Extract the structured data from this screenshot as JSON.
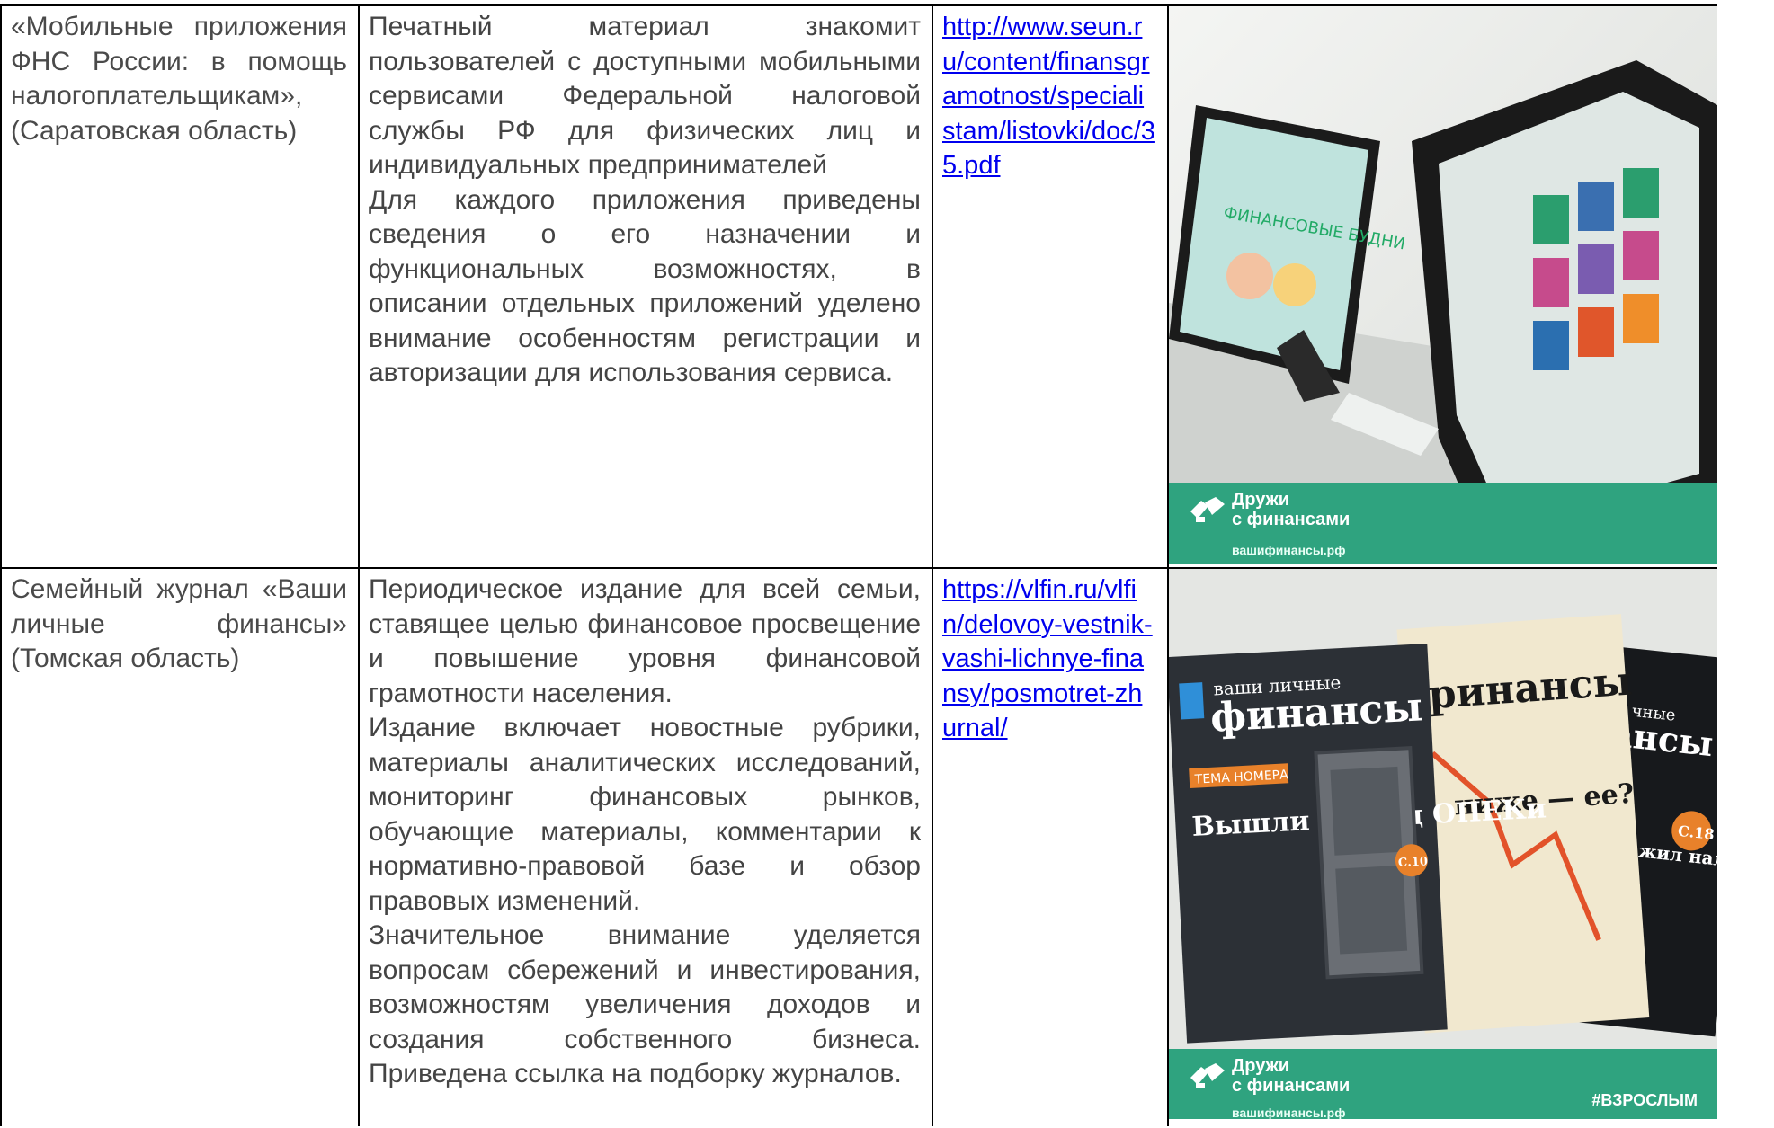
{
  "rows": [
    {
      "title": "«Мобильные приложения ФНС России: в помощь налогоплательщикам», (Саратовская область)",
      "desc": [
        "Печатный материал знакомит пользователей с доступными мобильными сервисами Федеральной налоговой службы РФ для физических лиц и индивидуальных предпринимателей",
        "Для каждого приложения приведены сведения о его назначении и функциональных возможностях, в описании отдельных приложений уделено внимание особенностям регистрации и авторизации для использования сервиса."
      ],
      "link": "http://www.seun.ru/content/finansgramotnost/specialistam/listovki/doc/35.pdf",
      "image": {
        "brand_line1": "Дружи",
        "brand_line2": "с финансами",
        "site": "вашифинансы.рф",
        "tablet_text": "ФИНАНСОВЫЕ БУДНИ"
      }
    },
    {
      "title": "Семейный журнал «Ваши личные финансы» (Томская область)",
      "desc": [
        "Периодическое издание для всей семьи, ставящее целью финансовое просвещение и повышение уровня финансовой грамотности населения.",
        "Издание включает новостные рубрики, материалы аналитических исследований, мониторинг финансовых рынков, обучающие материалы, комментарии к нормативно-правовой базе и обзор правовых изменений.",
        "Значительное внимание уделяется вопросам сбережений и инвестирования, возможностям увеличения доходов и создания собственного бизнеса. Приведена ссылка на подборку журналов."
      ],
      "link": "https://vlfin.ru/vlfin/delovoy-vestnik-vashi-lichnye-finansy/posmotret-zhurnal/",
      "image": {
        "brand_line1": "Дружи",
        "brand_line2": "с финансами",
        "site": "вашифинансы.рф",
        "hashtag": "#ВЗРОСЛЫМ",
        "mag_small": "ваши личные",
        "mag_big": "финансы",
        "mag_topic": "ТЕМА НОМЕРА",
        "mag_headline": "Вышли из-под ОПЕКи",
        "mag_page": "С.10",
        "mag2_big": "ринансы",
        "mag2_headline": "ниже — ее?",
        "mag3_small": "чные",
        "mag3_big": "ансы",
        "mag3_headline": "ет я жил налке, но видовали инистров шалов",
        "mag3_page": "С.18"
      }
    }
  ]
}
